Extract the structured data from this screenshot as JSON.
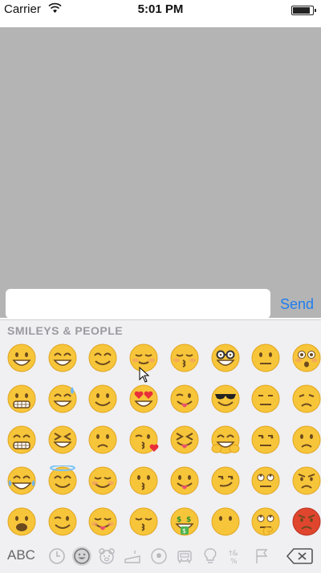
{
  "status_bar": {
    "carrier": "Carrier",
    "time": "5:01 PM"
  },
  "composer": {
    "input_value": "",
    "send_label": "Send",
    "send_color": "#1f7ef0"
  },
  "keyboard": {
    "category_title": "SMILEYS & PEOPLE",
    "abc_label": "ABC",
    "category_icons": [
      "recent-clock-icon",
      "smiley-face-icon",
      "animal-bear-icon",
      "food-cake-icon",
      "activity-ball-icon",
      "travel-car-icon",
      "objects-bulb-icon",
      "symbols-icon",
      "flags-icon"
    ],
    "active_category": "smiley-face-icon",
    "emoji_rows": [
      [
        "grinning-face-emoji",
        "grinning-big-eyes-emoji",
        "smiling-eyes-emoji",
        "relieved-face-emoji",
        "kissing-closed-eyes-emoji",
        "nerd-face-emoji",
        "neutral-face-emoji",
        "flushed-face-emoji"
      ],
      [
        "grimacing-face-emoji",
        "sweat-smile-emoji",
        "slightly-smiling-emoji",
        "heart-eyes-emoji",
        "winking-tongue-emoji",
        "sunglasses-face-emoji",
        "expressionless-face-emoji",
        "disappointed-face-emoji"
      ],
      [
        "grin-teeth-emoji",
        "laughing-squint-emoji",
        "upside-down-face-emoji",
        "kissing-heart-emoji",
        "squinting-tongue-emoji",
        "hugging-face-emoji",
        "unamused-face-emoji",
        "worried-face-emoji"
      ],
      [
        "crying-laughing-emoji",
        "halo-face-emoji",
        "smiling-blush-emoji",
        "kissing-face-emoji",
        "tongue-out-emoji",
        "smirking-face-emoji",
        "eye-roll-emoji",
        "angry-face-emoji"
      ],
      [
        "open-mouth-smile-emoji",
        "wink-face-emoji",
        "yum-face-emoji",
        "kissing-smiling-eyes-emoji",
        "money-mouth-emoji",
        "face-no-mouth-emoji",
        "thinking-face-emoji",
        "pouting-face-emoji"
      ]
    ]
  },
  "colors": {
    "emoji_yellow": "#f7c53a",
    "emoji_outline": "#e0a520",
    "emoji_feature": "#6b4a1e",
    "heart_red": "#e8303a",
    "tongue_pink": "#e8506a",
    "angry_red": "#e0452e"
  }
}
